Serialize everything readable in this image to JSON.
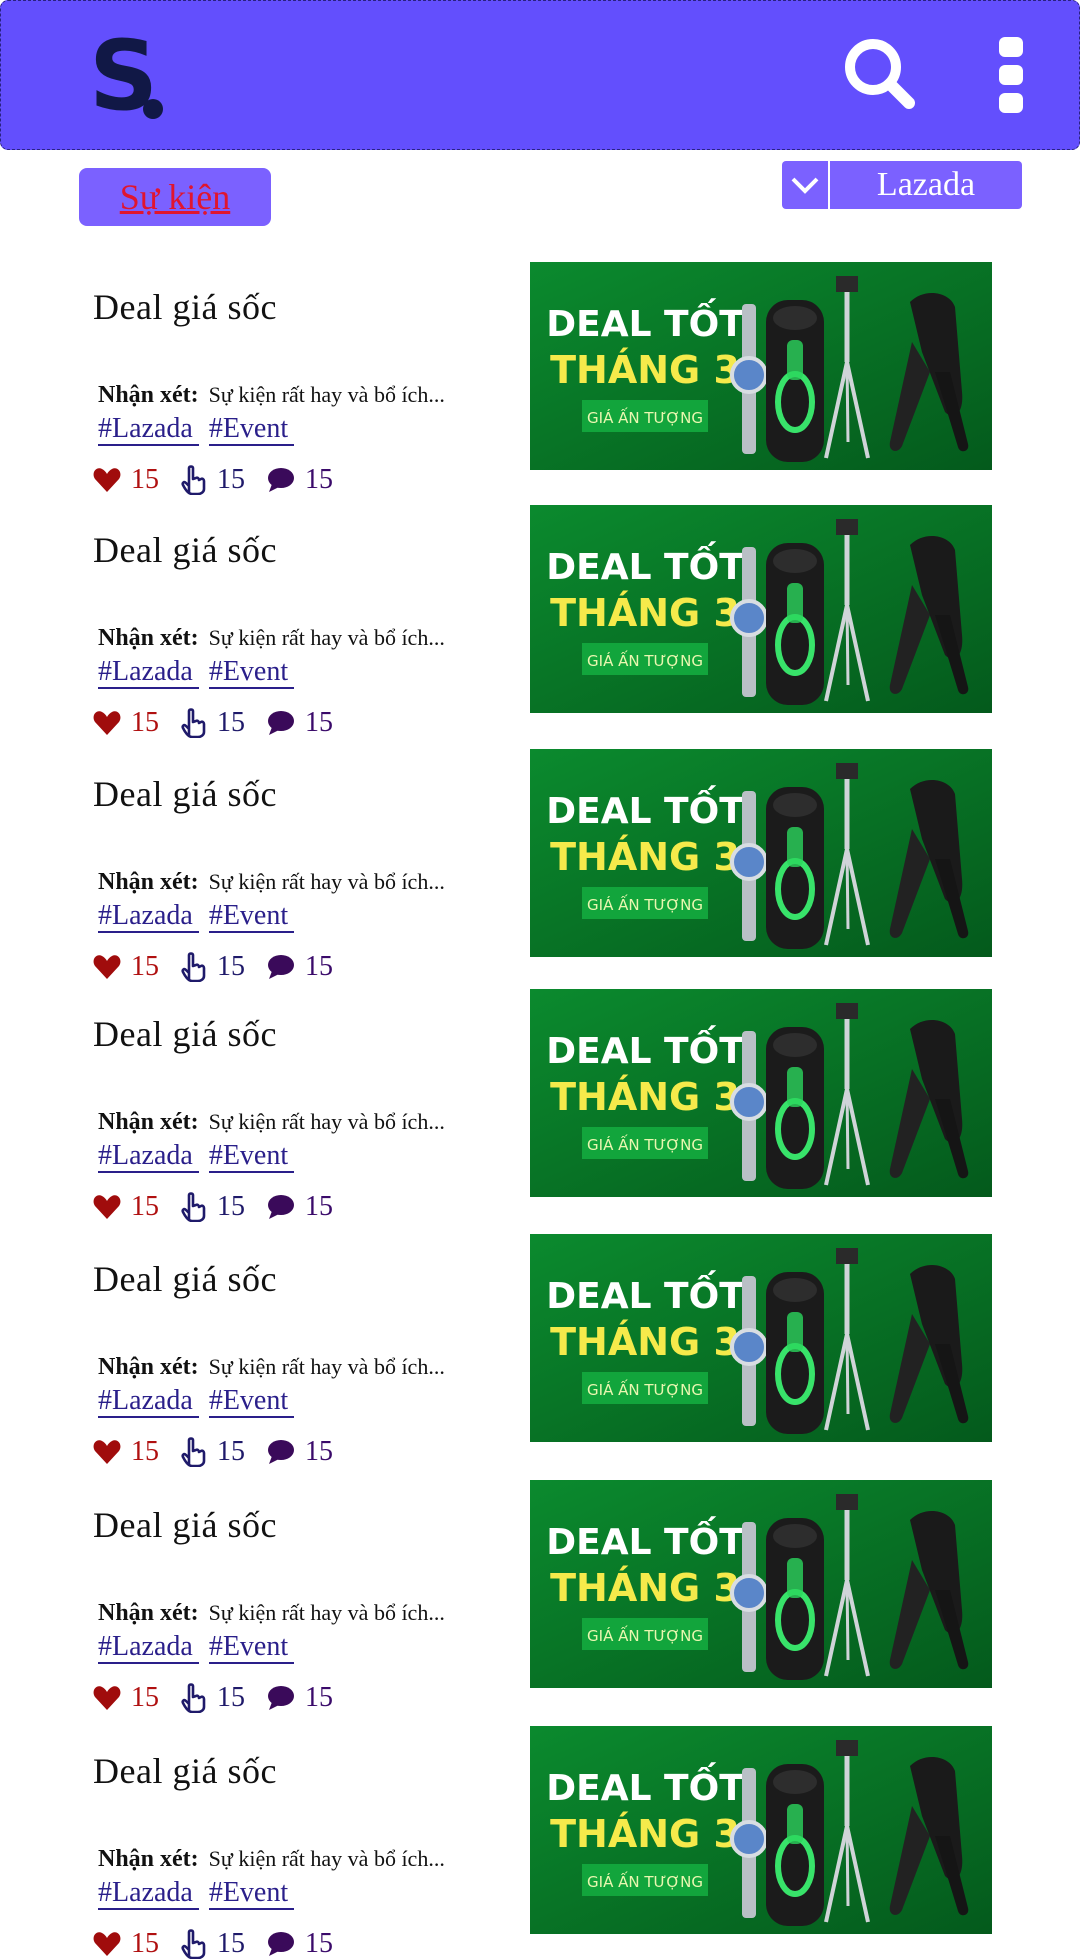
{
  "header": {
    "logo_letter": "S",
    "colors": {
      "bar": "#634ffd",
      "logo": "#111846"
    }
  },
  "filters": {
    "event_label": "Sự kiện",
    "store_selected": "Lazada"
  },
  "feed": [
    {
      "title": "Deal giá sốc",
      "review_label": "Nhận xét:",
      "review_text": "Sự kiện rất hay và bổ ích...",
      "tags": [
        "#Lazada",
        "#Event"
      ],
      "likes": "15",
      "claps": "15",
      "comments": "15",
      "banner": {
        "line1": "DEAL TỐT",
        "line2": "THÁNG 3",
        "cta": "GIÁ ẤN TƯỢNG"
      }
    },
    {
      "title": "Deal giá sốc",
      "review_label": "Nhận xét:",
      "review_text": "Sự kiện rất hay và bổ ích...",
      "tags": [
        "#Lazada",
        "#Event"
      ],
      "likes": "15",
      "claps": "15",
      "comments": "15",
      "banner": {
        "line1": "DEAL TỐT",
        "line2": "THÁNG 3",
        "cta": "GIÁ ẤN TƯỢNG"
      }
    },
    {
      "title": "Deal giá sốc",
      "review_label": "Nhận xét:",
      "review_text": "Sự kiện rất hay và bổ ích...",
      "tags": [
        "#Lazada",
        "#Event"
      ],
      "likes": "15",
      "claps": "15",
      "comments": "15",
      "banner": {
        "line1": "DEAL TỐT",
        "line2": "THÁNG 3",
        "cta": "GIÁ ẤN TƯỢNG"
      }
    },
    {
      "title": "Deal giá sốc",
      "review_label": "Nhận xét:",
      "review_text": "Sự kiện rất hay và bổ ích...",
      "tags": [
        "#Lazada",
        "#Event"
      ],
      "likes": "15",
      "claps": "15",
      "comments": "15",
      "banner": {
        "line1": "DEAL TỐT",
        "line2": "THÁNG 3",
        "cta": "GIÁ ẤN TƯỢNG"
      }
    },
    {
      "title": "Deal giá sốc",
      "review_label": "Nhận xét:",
      "review_text": "Sự kiện rất hay và bổ ích...",
      "tags": [
        "#Lazada",
        "#Event"
      ],
      "likes": "15",
      "claps": "15",
      "comments": "15",
      "banner": {
        "line1": "DEAL TỐT",
        "line2": "THÁNG 3",
        "cta": "GIÁ ẤN TƯỢNG"
      }
    },
    {
      "title": "Deal giá sốc",
      "review_label": "Nhận xét:",
      "review_text": "Sự kiện rất hay và bổ ích...",
      "tags": [
        "#Lazada",
        "#Event"
      ],
      "likes": "15",
      "claps": "15",
      "comments": "15",
      "banner": {
        "line1": "DEAL TỐT",
        "line2": "THÁNG 3",
        "cta": "GIÁ ẤN TƯỢNG"
      }
    },
    {
      "title": "Deal giá sốc",
      "review_label": "Nhận xét:",
      "review_text": "Sự kiện rất hay và bổ ích...",
      "tags": [
        "#Lazada",
        "#Event"
      ],
      "likes": "15",
      "claps": "15",
      "comments": "15",
      "banner": {
        "line1": "DEAL TỐT",
        "line2": "THÁNG 3",
        "cta": "GIÁ ẤN TƯỢNG"
      }
    }
  ]
}
